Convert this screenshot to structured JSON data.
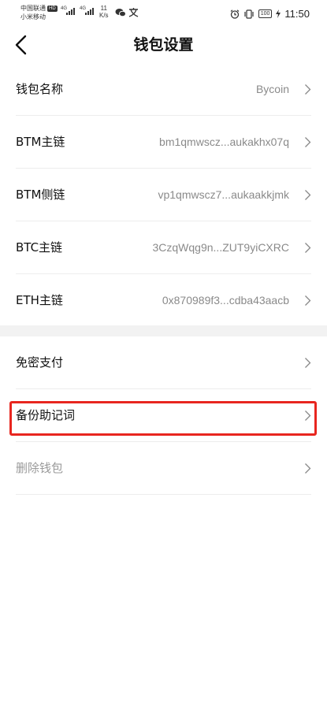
{
  "status_bar": {
    "carrier_line1": "中国联通",
    "carrier_badge": "HD",
    "carrier_line2": "小米移动",
    "net1": "4G",
    "net2": "4G",
    "speed_value": "11",
    "speed_unit": "K/s",
    "battery": "100",
    "time": "11:50"
  },
  "header": {
    "title": "钱包设置"
  },
  "settings": {
    "items": [
      {
        "label": "钱包名称",
        "value": "Bycoin"
      },
      {
        "label": "BTM主链",
        "value": "bm1qmwscz...aukakhx07q"
      },
      {
        "label": "BTM侧链",
        "value": "vp1qmwscz7...aukaakkjmk"
      },
      {
        "label": "BTC主链",
        "value": "3CzqWqg9n...ZUT9yiCXRC"
      },
      {
        "label": "ETH主链",
        "value": "0x870989f3...cdba43aacb"
      }
    ],
    "actions": [
      {
        "label": "免密支付"
      },
      {
        "label": "备份助记词"
      },
      {
        "label": "删除钱包"
      }
    ]
  },
  "colors": {
    "highlight": "#e8261f",
    "disabled_text": "#9a9a9a",
    "value_text": "#8a8a8a"
  }
}
